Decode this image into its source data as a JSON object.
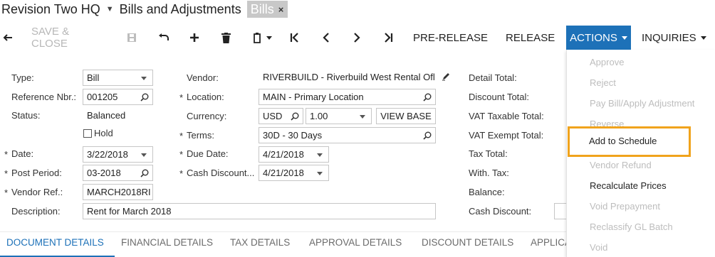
{
  "header": {
    "company": "Revision Two HQ",
    "screen": "Bills and Adjustments",
    "tab_label": "Bills",
    "tab_close": "×"
  },
  "toolbar": {
    "save_close": "SAVE & CLOSE",
    "pre_release": "PRE-RELEASE",
    "release": "RELEASE",
    "actions": "ACTIONS",
    "inquiries": "INQUIRIES",
    "accent_color": "#1d71b8"
  },
  "form": {
    "type_label": "Type:",
    "type_value": "Bill",
    "ref_label": "Reference Nbr.:",
    "ref_value": "001205",
    "status_label": "Status:",
    "status_value": "Balanced",
    "hold_label": "Hold",
    "date_label": "Date:",
    "date_value": "3/22/2018",
    "post_period_label": "Post Period:",
    "post_period_value": "03-2018",
    "vendor_ref_label": "Vendor Ref.:",
    "vendor_ref_value": "MARCH2018RI",
    "description_label": "Description:",
    "description_value": "Rent for March 2018",
    "vendor_label": "Vendor:",
    "vendor_value": "RIVERBUILD - Riverbuild West Rental Ofl",
    "location_label": "Location:",
    "location_value": "MAIN - Primary Location",
    "currency_label": "Currency:",
    "currency_value": "USD",
    "rate_value": "1.00",
    "view_base": "VIEW BASE",
    "terms_label": "Terms:",
    "terms_value": "30D - 30 Days",
    "due_date_label": "Due Date:",
    "due_date_value": "4/21/2018",
    "cash_discount_date_label": "Cash Discount...",
    "cash_discount_date_value": "4/21/2018",
    "detail_total_label": "Detail Total:",
    "discount_total_label": "Discount Total:",
    "vat_taxable_label": "VAT Taxable Total:",
    "vat_exempt_label": "VAT Exempt Total:",
    "tax_total_label": "Tax Total:",
    "with_tax_label": "With. Tax:",
    "balance_label": "Balance:",
    "cash_discount_label": "Cash Discount:",
    "required_marker": "*"
  },
  "tabs": [
    {
      "label": "DOCUMENT DETAILS"
    },
    {
      "label": "FINANCIAL DETAILS"
    },
    {
      "label": "TAX DETAILS"
    },
    {
      "label": "APPROVAL DETAILS"
    },
    {
      "label": "DISCOUNT DETAILS"
    },
    {
      "label": "APPLICA"
    }
  ],
  "actions_menu": [
    {
      "label": "Approve",
      "enabled": false
    },
    {
      "label": "Reject",
      "enabled": false
    },
    {
      "label": "Pay Bill/Apply Adjustment",
      "enabled": false
    },
    {
      "label": "Reverse",
      "enabled": false
    },
    {
      "label": "Add to Schedule",
      "enabled": true
    },
    {
      "label": "Vendor Refund",
      "enabled": false
    },
    {
      "label": "Recalculate Prices",
      "enabled": true
    },
    {
      "label": "Void Prepayment",
      "enabled": false
    },
    {
      "label": "Reclassify GL Batch",
      "enabled": false
    },
    {
      "label": "Void",
      "enabled": false
    }
  ],
  "highlight_color": "#f0a31c"
}
